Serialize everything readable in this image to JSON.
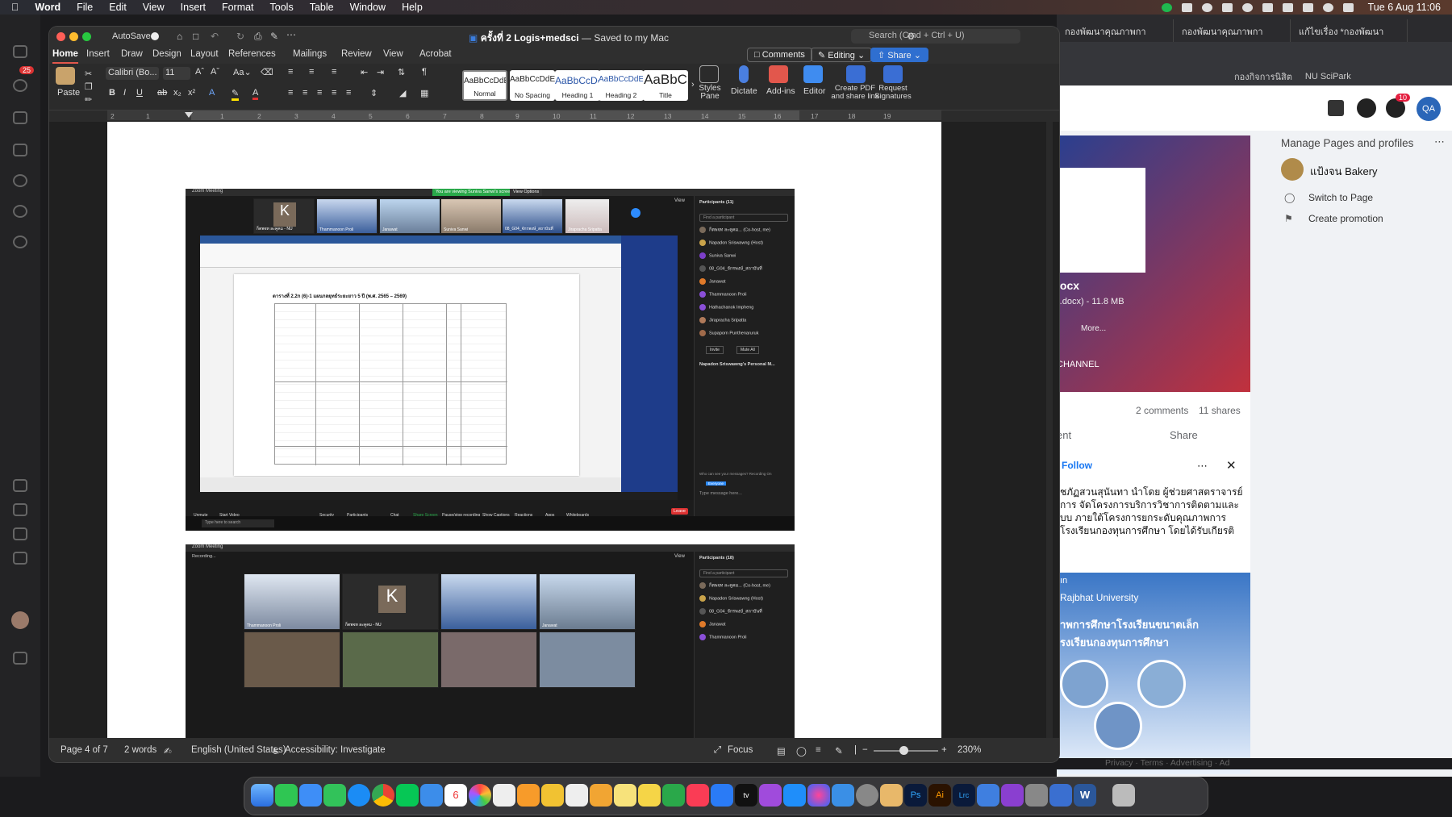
{
  "menubar": {
    "app": "Word",
    "items": [
      "File",
      "Edit",
      "View",
      "Insert",
      "Format",
      "Tools",
      "Table",
      "Window",
      "Help"
    ],
    "datetime": "Tue 6 Aug  11:06"
  },
  "browser": {
    "tabs": [
      "กองพัฒนาคุณภาพกา",
      "กองพัฒนาคุณภาพกา",
      "แก้ไขเรื่อง *กองพัฒนา"
    ],
    "bookmarks": [
      "กองกิจการนิสิต",
      "NU SciPark"
    ],
    "notif_count": "10",
    "account": "QA",
    "manage_title": "Manage Pages and profiles",
    "page_name": "แป้งจน Bakery",
    "switch_label": "Switch to Page",
    "promo_label": "Create promotion",
    "file_name": "locx",
    "file_info": "(.docx) - 11.8 MB",
    "more": "More...",
    "channel": "CHANNEL",
    "comments": "2 comments",
    "shares": "11 shares",
    "share_btn": "Share",
    "comment_btn": "ent",
    "follow": "Follow",
    "post_text": "ชภัฏสวนสุนันทา นำโดย ผู้ช่วยศาสตราจารย์ การ จัดโครงการบริการวิชาการติดตามและ บบ ภายใต้โครงการยกระดับคุณภาพการ โรงเรียนกองทุนการศึกษา โดยได้รับเกียรติ คณะครุศาสตร์ กล่าวเปิดโครงการ และมี",
    "banner_sub": "ın",
    "banner_uni": "Rajbhat University",
    "banner_line1": "าพการศึกษาโรงเรียนขนาดเล็ก",
    "banner_line2": "รงเรียนกองทุนการศึกษา",
    "footer_links": "Privacy · Terms · Advertising · Ad"
  },
  "teams": {
    "badge": "25"
  },
  "word": {
    "autosave": "AutoSave",
    "doc_title": "ครั้งที่ 2 Logis+medsci",
    "saved": "— Saved to my Mac",
    "search_placeholder": "Search (Cmd + Ctrl + U)",
    "tabs": [
      "Home",
      "Insert",
      "Draw",
      "Design",
      "Layout",
      "References",
      "Mailings",
      "Review",
      "View",
      "Acrobat"
    ],
    "comments_btn": "Comments",
    "editing_btn": "Editing",
    "share_btn": "Share",
    "paste": "Paste",
    "font_name": "Calibri (Bo...",
    "font_size": "11",
    "styles": [
      {
        "preview": "AaBbCcDdEe",
        "name": "Normal"
      },
      {
        "preview": "AaBbCcDdEe",
        "name": "No Spacing"
      },
      {
        "preview": "AaBbCcDc",
        "name": "Heading 1"
      },
      {
        "preview": "AaBbCcDdE",
        "name": "Heading 2"
      },
      {
        "preview": "AaBbC",
        "name": "Title"
      }
    ],
    "styles_pane": "Styles Pane",
    "dictate": "Dictate",
    "addins": "Add-ins",
    "editor": "Editor",
    "create_pdf": "Create PDF and share link",
    "request_sig": "Request Signatures",
    "ruler": [
      "2",
      "1",
      "1",
      "2",
      "3",
      "4",
      "5",
      "6",
      "7",
      "8",
      "9",
      "10",
      "11",
      "12",
      "13",
      "14",
      "15",
      "16",
      "17",
      "18",
      "19"
    ],
    "status": {
      "page": "Page 4 of 7",
      "words": "2 words",
      "language": "English (United States)",
      "accessibility": "Accessibility: Investigate",
      "focus": "Focus",
      "zoom": "230%"
    }
  },
  "zoom1": {
    "title": "Zoom Meeting",
    "banner": "You are viewing Suniva Sanwi's screen",
    "view_options": "View Options",
    "view": "View",
    "thumbs": [
      "ก็ตพจท ละคูคม - NU",
      "Thammanoon Proli",
      "Janawat",
      "Suniva Sanwi",
      "08_G04_จักรพงษ์_สถาบันที่",
      "Jirapracha Sripatta"
    ],
    "participants_title": "Participants (11)",
    "find": "Find a participant",
    "participants": [
      "ก็ตพจท ละคูคม... (Co-host, me)",
      "Napadon Sriswawng (Host)",
      "Suniva Sanwi",
      "08_G04_จักรพงษ์_สถาบันที่",
      "Janawat",
      "Thammanoon Proli",
      "Hathachanok Impheng",
      "Jirapracha Sripatta",
      "Supaporn Punthenaruruk"
    ],
    "invite": "Invite",
    "mute_all": "Mute All",
    "chat_title": "Napadon Sriswawng's Personal M...",
    "chat_note": "Who can see your messages? Recording On",
    "chat_to": "Everyone",
    "chat_placeholder": "Type message here...",
    "doc_heading": "ตารางที่ 2.2ก (6)-1 แผนกลยุทธ์ระยะยาว 5 ปี (พ.ศ. 2565 – 2569)",
    "leave": "Leave",
    "taskbar_search": "Type here to search",
    "controls": [
      "Unmute",
      "Start Video",
      "Security",
      "Participants",
      "Chat",
      "Share Screen",
      "Pause/stop recording",
      "Show Captions",
      "Reactions",
      "Apps",
      "Whiteboards"
    ]
  },
  "zoom2": {
    "title": "Zoom Meeting",
    "recording": "Recording...",
    "view": "View",
    "participants_title": "Participants (18)",
    "find": "Find a participant",
    "participants": [
      "ก็ตพจท ละคูคม... (Co-host, me)",
      "Napadon Sriswawng (Host)",
      "08_G04_จักรพงษ์_สถาบันที่",
      "Janawat",
      "Thammanoon Proli"
    ],
    "thumbs": [
      "Thammanoon Proli",
      "ก็ตพจท ละคูคม - NU",
      "",
      "Janawat"
    ]
  }
}
